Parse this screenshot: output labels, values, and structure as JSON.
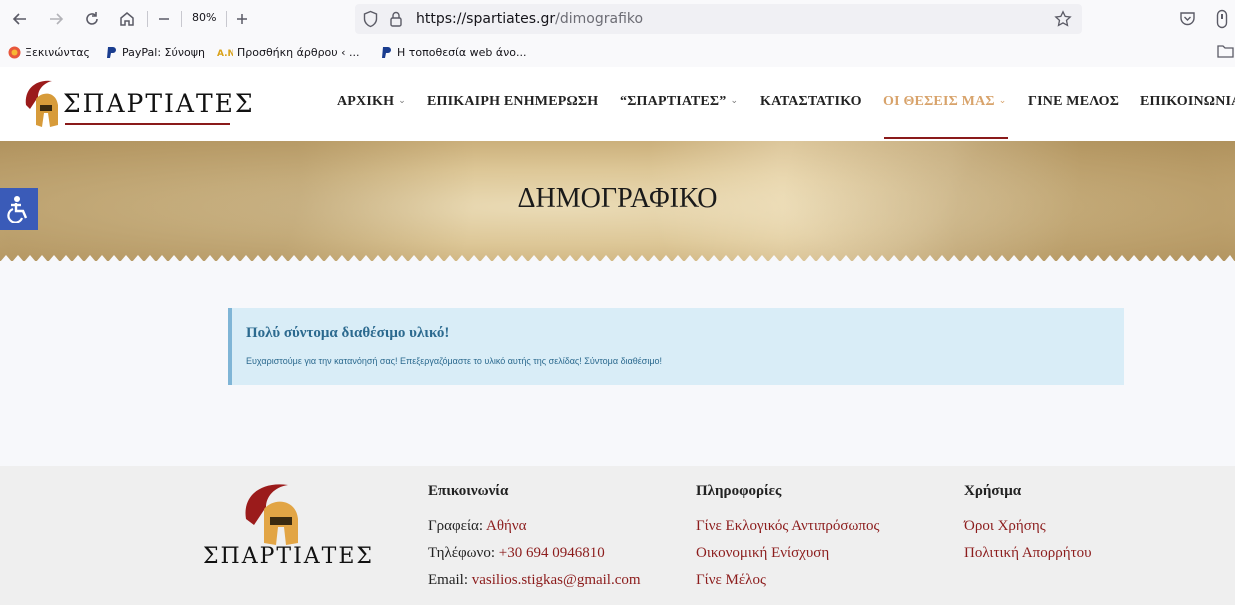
{
  "browser": {
    "zoom": "80%",
    "url_host": "https://spartiates.gr",
    "url_path": "/dimografiko",
    "bookmarks": [
      {
        "label": "Ξεκινώντας",
        "icon": "firefox-icon"
      },
      {
        "label": "PayPal: Σύνοψη",
        "icon": "paypal-icon"
      },
      {
        "label": "Προσθήκη άρθρου ‹ ...",
        "icon": "an-icon"
      },
      {
        "label": "Η τοποθεσία web άνο...",
        "icon": "paypal-icon"
      }
    ]
  },
  "site": {
    "logo_text": "ΣΠΑΡΤΙΑΤΕΣ",
    "nav": [
      {
        "label": "ΑΡΧΙΚΗ",
        "dropdown": true
      },
      {
        "label": "ΕΠΙΚΑΙΡΗ ΕΝΗΜΕΡΩΣΗ",
        "dropdown": false
      },
      {
        "label": "“ΣΠΑΡΤΙΑΤΕΣ”",
        "dropdown": true
      },
      {
        "label": "ΚΑΤΑΣΤΑΤΙΚΟ",
        "dropdown": false
      },
      {
        "label": "ΟΙ ΘΕΣΕΙΣ ΜΑΣ",
        "dropdown": true
      },
      {
        "label": "ΓΙΝΕ ΜΕΛΟΣ",
        "dropdown": false
      },
      {
        "label": "ΕΠΙΚΟΙΝΩΝΙΑ",
        "dropdown": false
      }
    ],
    "active_nav": "ΟΙ ΘΕΣΕΙΣ ΜΑΣ",
    "colors": {
      "accent": "#8a1a1a",
      "active_nav": "#d8a36b",
      "notice_bg": "#d9edf7",
      "notice_text": "#2c6a8f",
      "a11y": "#3a5bb8"
    }
  },
  "hero": {
    "title": "ΔΗΜΟΓΡΑΦΙΚΟ"
  },
  "notice": {
    "title": "Πολύ σύντομα διαθέσιμο υλικό!",
    "text": "Ευχαριστούμε για την κατανόησή σας! Επεξεργαζόμαστε το υλικό αυτής της σελίδας! Σύντομα διαθέσιμο!"
  },
  "footer": {
    "logo_text": "ΣΠΑΡΤΙΑΤΕΣ",
    "contact": {
      "heading": "Επικοινωνία",
      "office_label": "Γραφεία:",
      "office_value": "Αθήνα",
      "phone_label": "Τηλέφωνο:",
      "phone_value": "+30 694 0946810",
      "email_label": "Email:",
      "email_value": "vasilios.stigkas@gmail.com"
    },
    "info": {
      "heading": "Πληροφορίες",
      "links": [
        "Γίνε Εκλογικός Αντιπρόσωπος",
        "Οικονομική Ενίσχυση",
        "Γίνε Μέλος"
      ]
    },
    "useful": {
      "heading": "Χρήσιμα",
      "links": [
        "Όροι Χρήσης",
        "Πολιτική Απορρήτου"
      ]
    }
  }
}
